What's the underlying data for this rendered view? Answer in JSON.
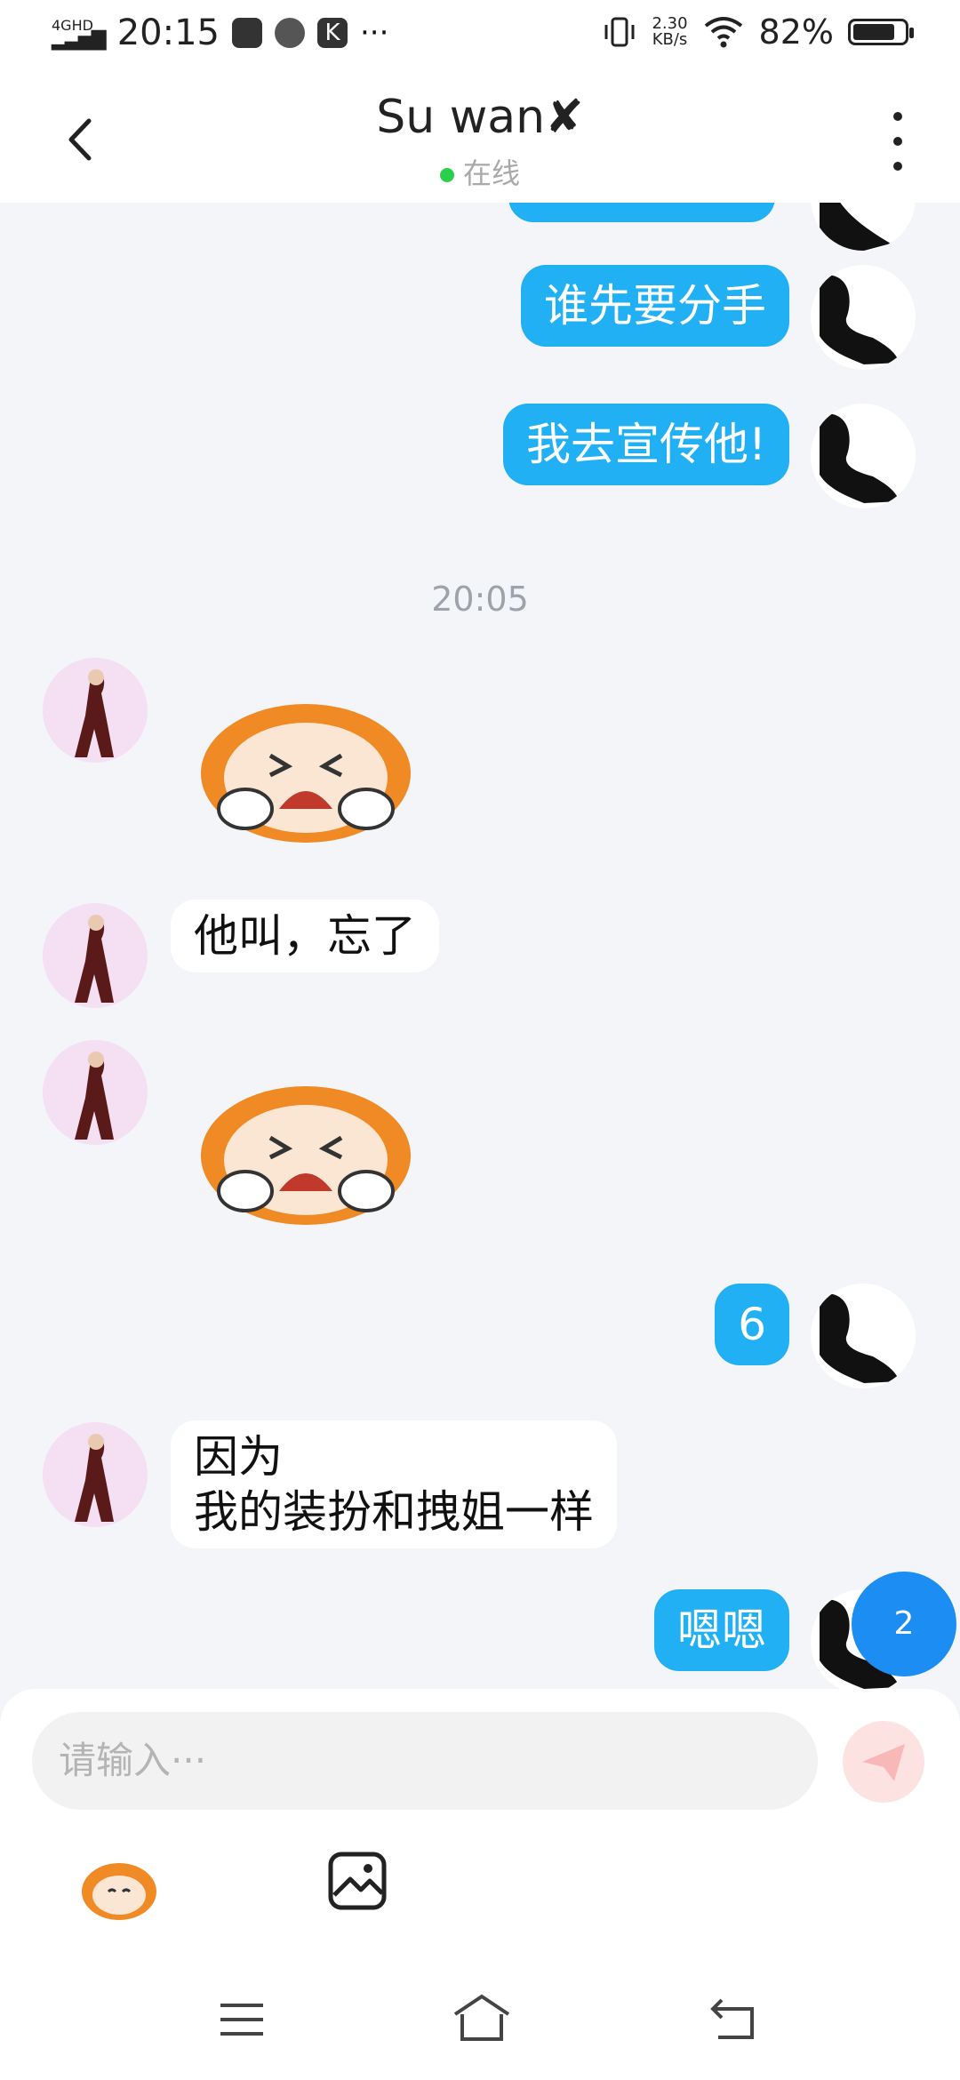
{
  "status_bar": {
    "time": "20:15",
    "network": "4GHD",
    "speed_value": "2.30",
    "speed_unit": "KB/s",
    "battery_percent": "82%",
    "battery_level": 0.82
  },
  "header": {
    "title": "Su wan✘",
    "status": "在线",
    "status_color": "#2bd04a"
  },
  "messages": {
    "m1": "谁先要分手",
    "m2": "我去宣传他!",
    "timestamp": "20:05",
    "m3": "他叫，忘了",
    "m4": "6",
    "m5": "因为\n我的装扮和拽姐一样",
    "m6": "嗯嗯"
  },
  "unread_badge": "2",
  "input": {
    "placeholder": "请输入···"
  },
  "colors": {
    "outgoing_bubble": "#21b0f3",
    "incoming_bubble": "#ffffff",
    "background": "#f3f5f9",
    "badge": "#1c8df2"
  },
  "icons": {
    "back": "chevron-left-icon",
    "more": "more-vertical-icon",
    "send": "paper-plane-icon",
    "emoji": "emoji-sticker-icon",
    "image": "image-icon",
    "nav_menu": "menu-icon",
    "nav_home": "home-icon",
    "nav_back": "return-icon"
  }
}
